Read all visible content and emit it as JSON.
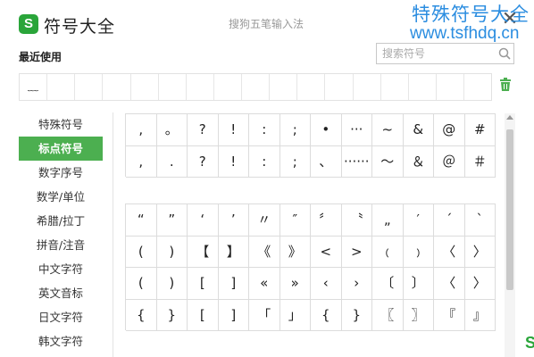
{
  "app": {
    "logo_letter": "S",
    "title": "符号大全",
    "ime_name": "搜狗五笔输入法",
    "close_glyph": "✕"
  },
  "watermark": {
    "line1": "特殊符号大全",
    "line2": "www.tsfhdq.cn"
  },
  "recent": {
    "label": "最近使用",
    "symbols": [
      "﹏",
      "",
      "",
      "",
      "",
      "",
      "",
      "",
      "",
      "",
      "",
      "",
      "",
      "",
      "",
      "",
      ""
    ]
  },
  "search": {
    "placeholder": "搜索符号"
  },
  "sidebar": {
    "items": [
      {
        "label": "特殊符号",
        "active": false
      },
      {
        "label": "标点符号",
        "active": true
      },
      {
        "label": "数字序号",
        "active": false
      },
      {
        "label": "数学/单位",
        "active": false
      },
      {
        "label": "希腊/拉丁",
        "active": false
      },
      {
        "label": "拼音/注音",
        "active": false
      },
      {
        "label": "中文字符",
        "active": false
      },
      {
        "label": "英文音标",
        "active": false
      },
      {
        "label": "日文字符",
        "active": false
      },
      {
        "label": "韩文字符",
        "active": false
      }
    ]
  },
  "grids": [
    {
      "rows": [
        [
          ",",
          "。",
          "?",
          "!",
          ":",
          ";",
          "•",
          "···",
          "~",
          "&",
          "@",
          "#"
        ],
        [
          ",",
          ".",
          "?",
          "!",
          ":",
          ";",
          "、",
          "······",
          "～",
          "＆",
          "＠",
          "＃"
        ]
      ]
    },
    {
      "rows": [
        [
          "“",
          "”",
          "‘",
          "’",
          "〃",
          "″",
          "〞",
          "〝",
          "„",
          "′",
          "ˊ",
          "ˋ"
        ],
        [
          "(",
          ")",
          "【",
          "】",
          "《",
          "》",
          "<",
          ">",
          "﹙",
          "﹚",
          "〈",
          "〉"
        ],
        [
          "(",
          ")",
          "[",
          "]",
          "«",
          "»",
          "‹",
          "›",
          "〔",
          "〕",
          "〈",
          "〉"
        ],
        [
          "{",
          "}",
          "[",
          "]",
          "「",
          "」",
          "{",
          "}",
          "〖",
          "〗",
          "『",
          "』"
        ]
      ]
    }
  ],
  "colors": {
    "accent": "#4caf50",
    "watermark": "#2b8de0"
  },
  "icons": {
    "search": "search-icon",
    "trash": "trash-icon",
    "close": "close-icon"
  }
}
